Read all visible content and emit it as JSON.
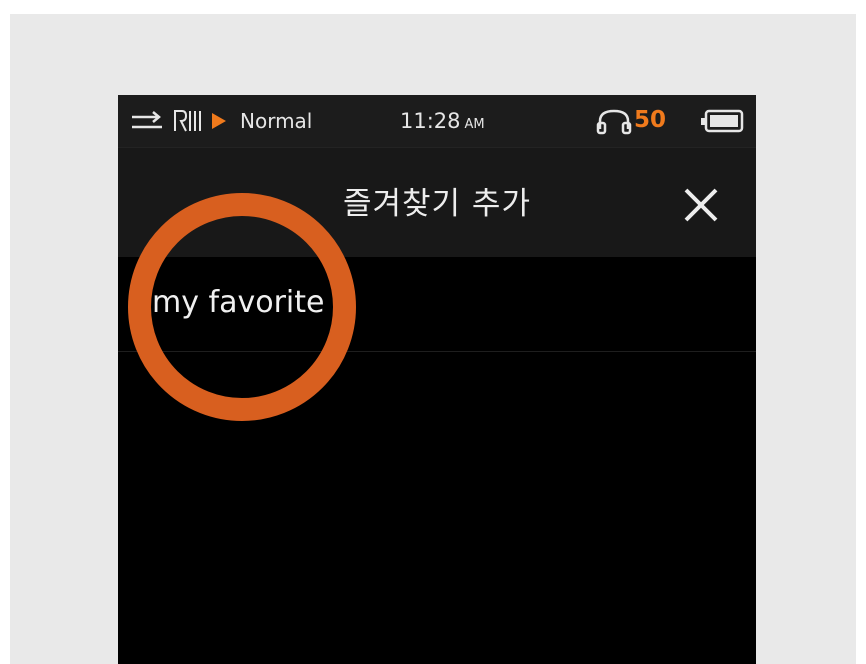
{
  "status_bar": {
    "mode": "Normal",
    "time": "11:28",
    "ampm": "AM",
    "volume": "50",
    "accent_color": "#f07a1c"
  },
  "header": {
    "title": "즐겨찾기 추가"
  },
  "list": {
    "items": [
      {
        "label": "my favorite"
      }
    ]
  },
  "annotation": {
    "ring_color": "#d85f1f"
  },
  "icons": {
    "repeat": "repeat-icon",
    "rill": "rill-icon",
    "play": "play-icon",
    "headphone": "headphone-icon",
    "battery": "battery-icon",
    "close": "close-icon"
  }
}
